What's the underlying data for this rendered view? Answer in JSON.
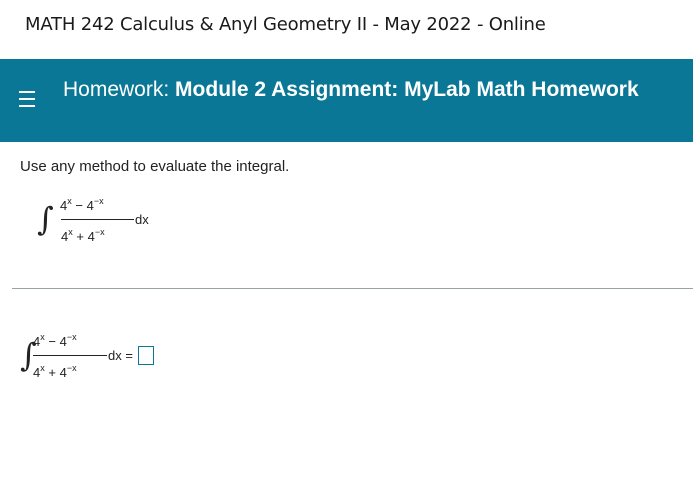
{
  "course": {
    "title": "MATH 242 Calculus & Anyl Geometry II - May 2022 - Online"
  },
  "header": {
    "menu_icon": "hamburger-menu-icon",
    "prefix": "Homework:",
    "assignment_name": "Module 2 Assignment: MyLab Math Homework",
    "background_color": "#0b7796"
  },
  "problem": {
    "instructions": "Use any method to evaluate the integral.",
    "integral_sign": "∫",
    "numerator_base1": "4",
    "numerator_exp1": "x",
    "numerator_op": "−",
    "numerator_base2": "4",
    "numerator_exp2": "−x",
    "denominator_base1": "4",
    "denominator_exp1": "x",
    "denominator_op": "+",
    "denominator_base2": "4",
    "denominator_exp2": "−x",
    "differential": "dx",
    "equals_differential": "dx ="
  }
}
